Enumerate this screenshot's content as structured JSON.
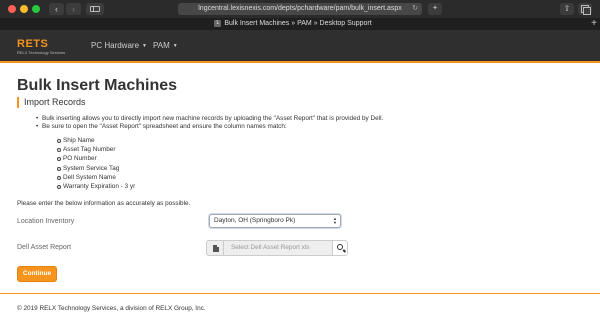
{
  "browser": {
    "url": "lngcentral.lexisnexis.com/depts/pchardware/pam/bulk_insert.aspx",
    "tab_title": "Bulk Insert Machines » PAM » Desktop Support",
    "tab_favicon": "L"
  },
  "site": {
    "logo": "RETS",
    "logo_subtitle": "RELX Technology Services",
    "nav": [
      "PC Hardware",
      "PAM"
    ]
  },
  "page": {
    "title": "Bulk Insert Machines",
    "section": "Import Records",
    "bullets": [
      "Bulk inserting allows you to directly import new machine records by uploading the \"Asset Report\" that is provided by Dell.",
      "Be sure to open the \"Asset Report\" spreadsheet and ensure the column names match:"
    ],
    "columns": [
      "Ship Name",
      "Asset Tag Number",
      "PO Number",
      "System Service Tag",
      "Dell System Name",
      "Warranty Expiration - 3 yr"
    ],
    "instructions": "Please enter the below information as accurately as possible."
  },
  "form": {
    "location_label": "Location Inventory",
    "location_value": "Dayton, OH (Springboro Pk)",
    "dell_label": "Dell Asset Report",
    "dell_placeholder": "Select Dell Asset Report xls",
    "continue": "Continue"
  },
  "footer": {
    "text": "© 2019 RELX Technology Services, a division of RELX Group, Inc."
  },
  "colors": {
    "accent": "#f7941d",
    "nav_bg": "#2f2f2f"
  }
}
